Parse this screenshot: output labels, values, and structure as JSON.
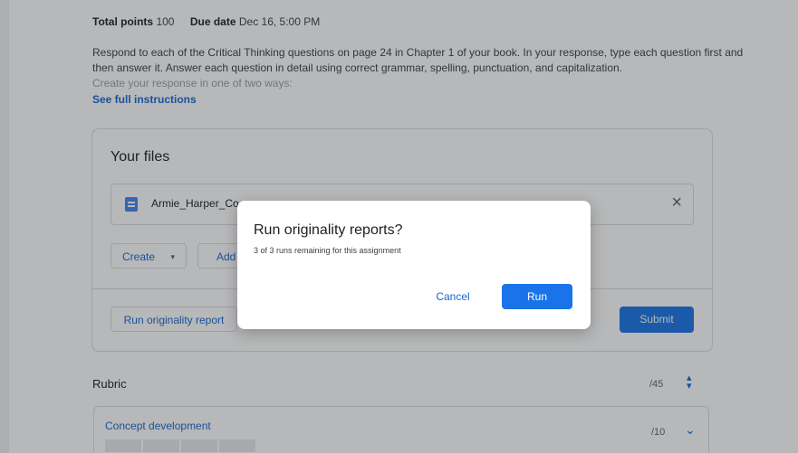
{
  "assignment": {
    "points_label": "Total points",
    "points_value": "100",
    "due_label": "Due date",
    "due_value": "Dec 16, 5:00 PM",
    "instructions_line1": "Respond to each of the Critical Thinking questions on page 24 in Chapter 1 of your book. In your response, type each question first and then answer it. Answer each question in detail using correct grammar, spelling, punctuation, and capitalization.",
    "instructions_line2": "Create your response in one of two ways:",
    "see_full_instructions": "See full instructions"
  },
  "files_card": {
    "title": "Your files",
    "file_name": "Armie_Harper_Co",
    "remove_icon": "×",
    "create_label": "Create",
    "create_caret": "▾",
    "add_label": "Add",
    "run_report_label": "Run originality report",
    "submit_label": "Submit"
  },
  "rubric": {
    "title": "Rubric",
    "score": "/45",
    "toggle_icon": "▴▾",
    "criterion": {
      "title": "Concept development",
      "score": "/10",
      "toggle_icon": "⌄"
    }
  },
  "dialog": {
    "title": "Run originality reports?",
    "subtitle": "3 of 3 runs remaining for this assignment",
    "cancel_label": "Cancel",
    "run_label": "Run"
  },
  "colors": {
    "accent": "#1a73e8",
    "link": "#1967d2",
    "scrim": "rgba(32,33,36,0.32)"
  }
}
